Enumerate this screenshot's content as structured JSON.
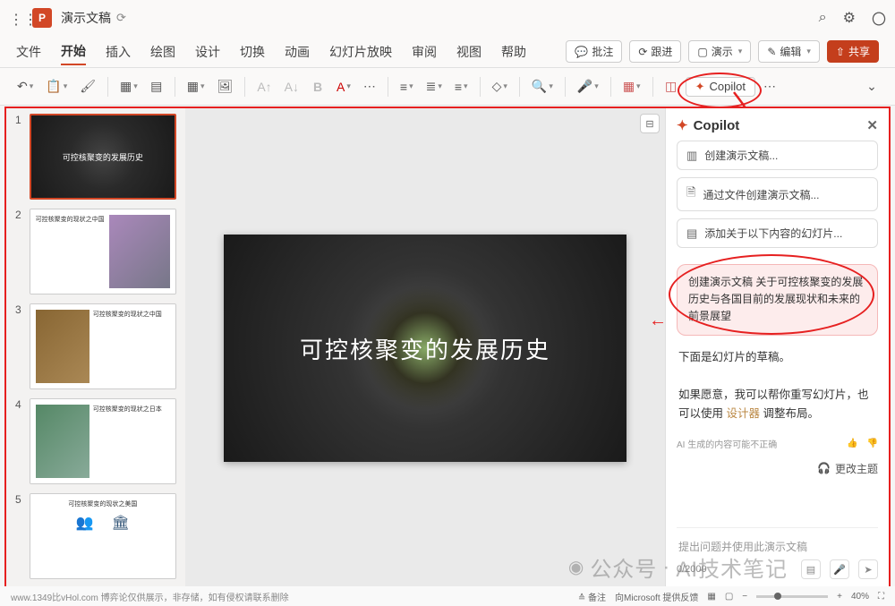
{
  "app": {
    "badge": "P",
    "title": "演示文稿",
    "cloud_saved": "⟳"
  },
  "titlebar_right": {
    "search": "⌕",
    "settings": "⚙",
    "user": "〇"
  },
  "tabs": {
    "file": "文件",
    "home": "开始",
    "insert": "插入",
    "draw": "绘图",
    "design": "设计",
    "transition": "切换",
    "animation": "动画",
    "slideshow": "幻灯片放映",
    "review": "审阅",
    "view": "视图",
    "help": "帮助"
  },
  "tab_right": {
    "comments": "批注",
    "catchup": "跟进",
    "present": "演示",
    "edit": "编辑",
    "share": "共享"
  },
  "toolbar": {
    "copilot": "Copilot",
    "more": "⋯"
  },
  "slide": {
    "title": "可控核聚变的发展历史"
  },
  "thumbs": {
    "t1": "可控核聚变的发展历史",
    "t2_title": "可控核聚变的现状之中国",
    "t3_title": "可控核聚变的现状之中国",
    "t4_title": "可控核聚变的现状之日本",
    "t5_title": "可控核聚变的现状之美国"
  },
  "copilot": {
    "title": "Copilot",
    "sugg1": "创建演示文稿...",
    "sugg2": "通过文件创建演示文稿...",
    "sugg3": "添加关于以下内容的幻灯片...",
    "user_msg": "创建演示文稿 关于可控核聚变的发展历史与各国目前的发展现状和未来的前景展望",
    "assist1": "下面是幻灯片的草稿。",
    "assist2_a": "如果愿意，我可以帮你重写幻灯片，也可以使用 ",
    "assist2_link": "设计器",
    "assist2_b": " 调整布局。",
    "disclaimer": "AI 生成的内容可能不正确",
    "change_theme": "更改主题",
    "input_placeholder": "提出问题并使用此演示文稿",
    "count": "0/2000"
  },
  "status": {
    "left": "www.1349比vHol.com 博弈论仅供展示，非存储，如有侵权请联系删除",
    "notes": "备注",
    "feedback": "向Microsoft 提供反馈",
    "zoom": "40%"
  },
  "watermark": {
    "prefix": "公众号",
    "name": "AI技术笔记"
  }
}
